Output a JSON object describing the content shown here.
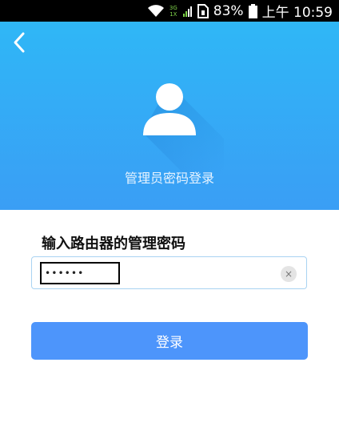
{
  "status_bar": {
    "network_top": "3G",
    "network_bottom": "1X",
    "battery": "83%",
    "time": "上午 10:59",
    "icons": [
      "wifi-icon",
      "signal-icon",
      "sim-icon",
      "battery-icon"
    ]
  },
  "header": {
    "title": "管理员密码登录",
    "back_icon": "chevron-left-icon",
    "avatar_icon": "user-icon"
  },
  "form": {
    "label": "输入路由器的管理密码",
    "password_value": "••••••",
    "clear_icon": "close-icon",
    "clear_symbol": "×",
    "submit_label": "登录"
  },
  "colors": {
    "header_top": "#2fb7f6",
    "header_bottom": "#3a9ef5",
    "button": "#4d95fb",
    "input_border": "#a9d3f2"
  }
}
